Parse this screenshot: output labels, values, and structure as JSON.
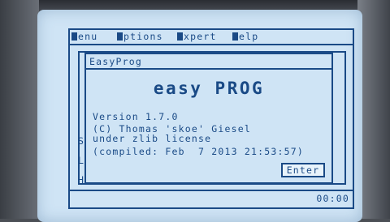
{
  "menubar": {
    "items": [
      {
        "label": "enu"
      },
      {
        "label": "ptions"
      },
      {
        "label": "xpert"
      },
      {
        "label": "elp"
      }
    ]
  },
  "side_letters": [
    "S",
    "L",
    "H"
  ],
  "status": {
    "clock": "00:00"
  },
  "dialog": {
    "title": "EasyProg",
    "logo": "easy PROG",
    "version": "Version 1.7.0",
    "copyright_line1": "(C) Thomas 'skoe' Giesel",
    "copyright_line2": "under zlib license",
    "compiled": "(compiled: Feb  7 2013 21:53:57)",
    "button_label": "Enter"
  },
  "colors": {
    "screen": "#cfe4f5",
    "ink": "#1a4a86"
  }
}
